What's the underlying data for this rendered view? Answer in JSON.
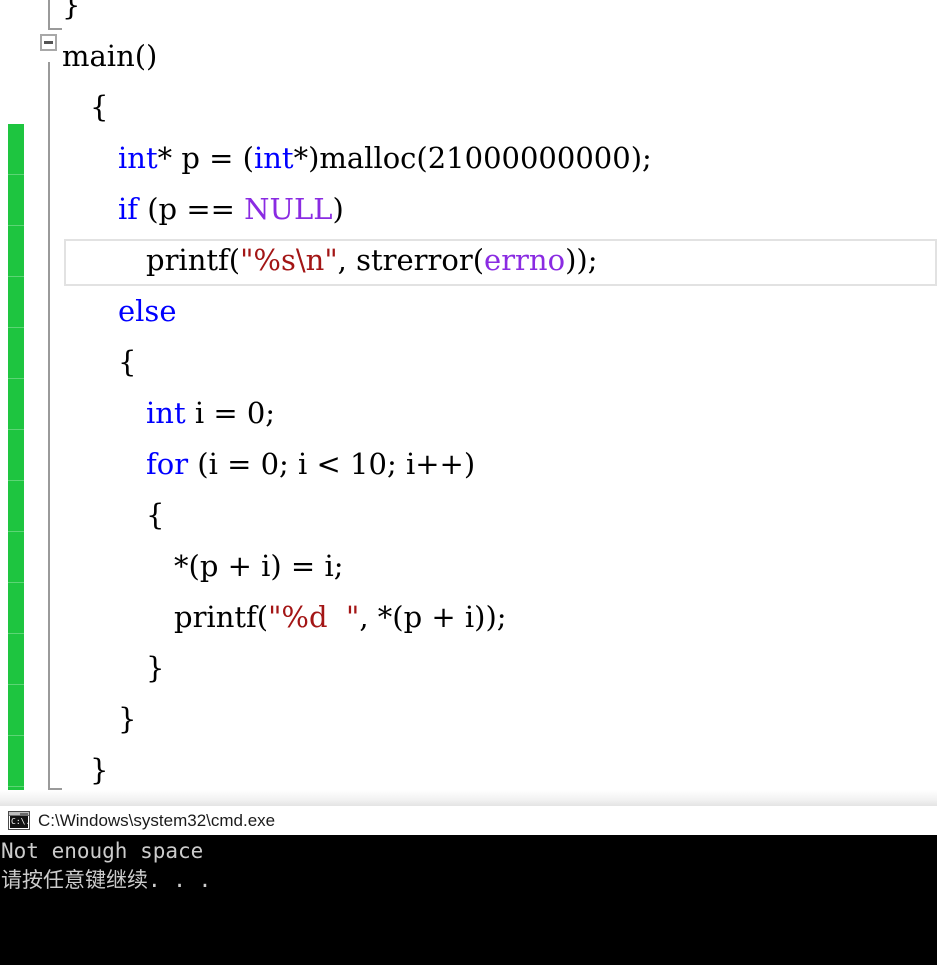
{
  "editor": {
    "language": "c",
    "change_bar_color": "#1ec540",
    "background_color": "#ffffff",
    "collapse_toggle": {
      "name": "collapse-main-function",
      "state": "expanded",
      "glyph": "minus"
    },
    "syntax_colors": {
      "keyword": "#0000ff",
      "macro": "#8a2be2",
      "string": "#a31515",
      "plain": "#000000"
    },
    "current_line_index": 5,
    "lines": [
      {
        "indent": 0,
        "tokens": [
          {
            "text": "}",
            "kind": "plain"
          }
        ]
      },
      {
        "indent": 0,
        "tokens": [
          {
            "text": "main()",
            "kind": "plain"
          }
        ]
      },
      {
        "indent": 1,
        "tokens": [
          {
            "text": "{",
            "kind": "plain"
          }
        ]
      },
      {
        "indent": 2,
        "tokens": [
          {
            "text": "int",
            "kind": "keyword"
          },
          {
            "text": "* p = (",
            "kind": "plain"
          },
          {
            "text": "int",
            "kind": "keyword"
          },
          {
            "text": "*)malloc(21000000000);",
            "kind": "plain"
          }
        ]
      },
      {
        "indent": 2,
        "tokens": [
          {
            "text": "if",
            "kind": "keyword"
          },
          {
            "text": " (p == ",
            "kind": "plain"
          },
          {
            "text": "NULL",
            "kind": "macro"
          },
          {
            "text": ")",
            "kind": "plain"
          }
        ]
      },
      {
        "indent": 3,
        "tokens": [
          {
            "text": "printf(",
            "kind": "plain"
          },
          {
            "text": "\"%s\\n\"",
            "kind": "string"
          },
          {
            "text": ", strerror(",
            "kind": "plain"
          },
          {
            "text": "errno",
            "kind": "macro"
          },
          {
            "text": "));",
            "kind": "plain"
          }
        ]
      },
      {
        "indent": 2,
        "tokens": [
          {
            "text": "else",
            "kind": "keyword"
          }
        ]
      },
      {
        "indent": 2,
        "tokens": [
          {
            "text": "{",
            "kind": "plain"
          }
        ]
      },
      {
        "indent": 3,
        "tokens": [
          {
            "text": "int",
            "kind": "keyword"
          },
          {
            "text": " i = 0;",
            "kind": "plain"
          }
        ]
      },
      {
        "indent": 3,
        "tokens": [
          {
            "text": "for",
            "kind": "keyword"
          },
          {
            "text": " (i = 0; i < 10; i++)",
            "kind": "plain"
          }
        ]
      },
      {
        "indent": 3,
        "tokens": [
          {
            "text": "{",
            "kind": "plain"
          }
        ]
      },
      {
        "indent": 4,
        "tokens": [
          {
            "text": "*(p + i) = i;",
            "kind": "plain"
          }
        ]
      },
      {
        "indent": 4,
        "tokens": [
          {
            "text": "printf(",
            "kind": "plain"
          },
          {
            "text": "\"%d  \"",
            "kind": "string"
          },
          {
            "text": ", *(p + i));",
            "kind": "plain"
          }
        ]
      },
      {
        "indent": 3,
        "tokens": [
          {
            "text": "}",
            "kind": "plain"
          }
        ]
      },
      {
        "indent": 2,
        "tokens": [
          {
            "text": "}",
            "kind": "plain"
          }
        ]
      },
      {
        "indent": 1,
        "tokens": [
          {
            "text": "}",
            "kind": "plain"
          }
        ]
      }
    ]
  },
  "console": {
    "title": "C:\\Windows\\system32\\cmd.exe",
    "icon": "cmd-icon",
    "icon_glyph": "C:\\.",
    "background_color": "#000000",
    "text_color": "#cccccc",
    "output_lines": [
      "Not enough space",
      "请按任意键继续. . ."
    ]
  }
}
